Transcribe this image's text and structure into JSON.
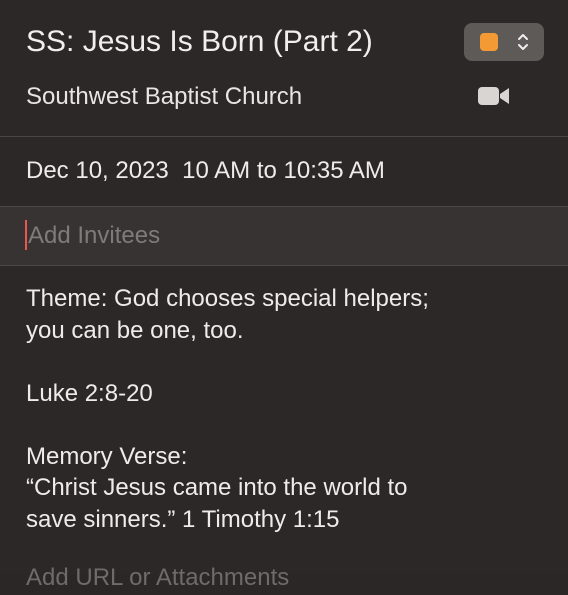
{
  "event": {
    "title": "SS: Jesus Is Born (Part 2)",
    "location": "Southwest Baptist Church",
    "date": "Dec 10, 2023",
    "time_range": "10 AM to 10:35 AM",
    "calendar_color": "#f39a35"
  },
  "invitees": {
    "placeholder": "Add Invitees",
    "value": ""
  },
  "notes": {
    "line1": "Theme: God chooses special helpers;",
    "line2": "you can be one, too.",
    "line3": "Luke 2:8-20",
    "line4": "Memory Verse:",
    "line5": "“Christ Jesus came into the world to",
    "line6": "save sinners.” 1 Timothy 1:15"
  },
  "footer": {
    "url_attachments_hint": "Add URL or Attachments"
  },
  "icons": {
    "calendar_picker": "chevron-up-down-icon",
    "video": "video-camera-icon"
  }
}
